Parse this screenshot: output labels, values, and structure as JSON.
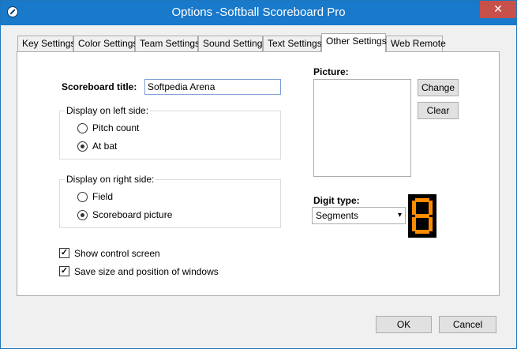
{
  "window": {
    "title": "Options -Softball Scoreboard Pro",
    "close_glyph": "✕"
  },
  "tabs": [
    {
      "label": "Key Settings"
    },
    {
      "label": "Color Settings"
    },
    {
      "label": "Team Settings"
    },
    {
      "label": "Sound Settings"
    },
    {
      "label": "Text Settings"
    },
    {
      "label": "Other Settings",
      "active": true
    },
    {
      "label": "Web Remote"
    }
  ],
  "scoreboard_title": {
    "label": "Scoreboard title:",
    "value": "Softpedia Arena"
  },
  "left_side": {
    "label": "Display on left side:",
    "options": [
      "Pitch count",
      "At bat"
    ],
    "selected": "At bat"
  },
  "right_side": {
    "label": "Display on right side:",
    "options": [
      "Field",
      "Scoreboard picture"
    ],
    "selected": "Scoreboard picture"
  },
  "checkboxes": [
    {
      "label": "Show control screen",
      "checked": true,
      "mark": "✓"
    },
    {
      "label": "Save size and position of windows",
      "checked": true,
      "mark": "✓"
    }
  ],
  "picture": {
    "label": "Picture:",
    "change_label": "Change",
    "clear_label": "Clear"
  },
  "digit_type": {
    "label": "Digit type:",
    "selected": "Segments",
    "arrow": "▾",
    "preview_digit": "8",
    "segment_color": "#ff8c00"
  },
  "footer": {
    "ok_label": "OK",
    "cancel_label": "Cancel"
  },
  "colors": {
    "titlebar": "#1979ca",
    "close": "#c7504b"
  }
}
